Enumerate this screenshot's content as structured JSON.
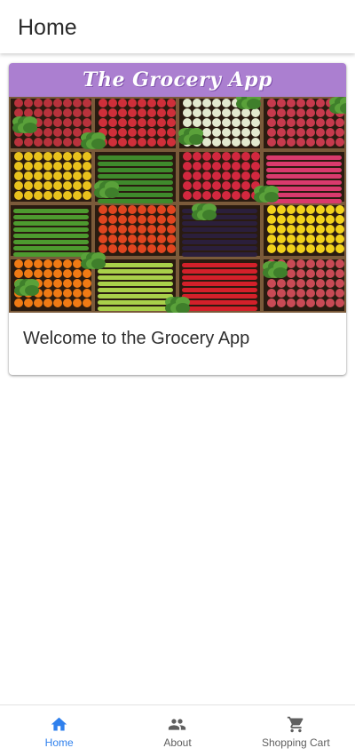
{
  "header": {
    "title": "Home"
  },
  "card": {
    "banner_title": "The Grocery App",
    "welcome_text": "Welcome to the Grocery App"
  },
  "bottom_nav": {
    "active_color": "#2f80ed",
    "inactive_color": "#5f5f5f",
    "items": [
      {
        "label": "Home",
        "icon": "home-icon",
        "active": true
      },
      {
        "label": "About",
        "icon": "people-icon",
        "active": false
      },
      {
        "label": "Shopping Cart",
        "icon": "shopping-cart-icon",
        "active": false
      }
    ]
  },
  "colors": {
    "banner_background": "#ab7fd0",
    "banner_text": "#ffffff"
  }
}
